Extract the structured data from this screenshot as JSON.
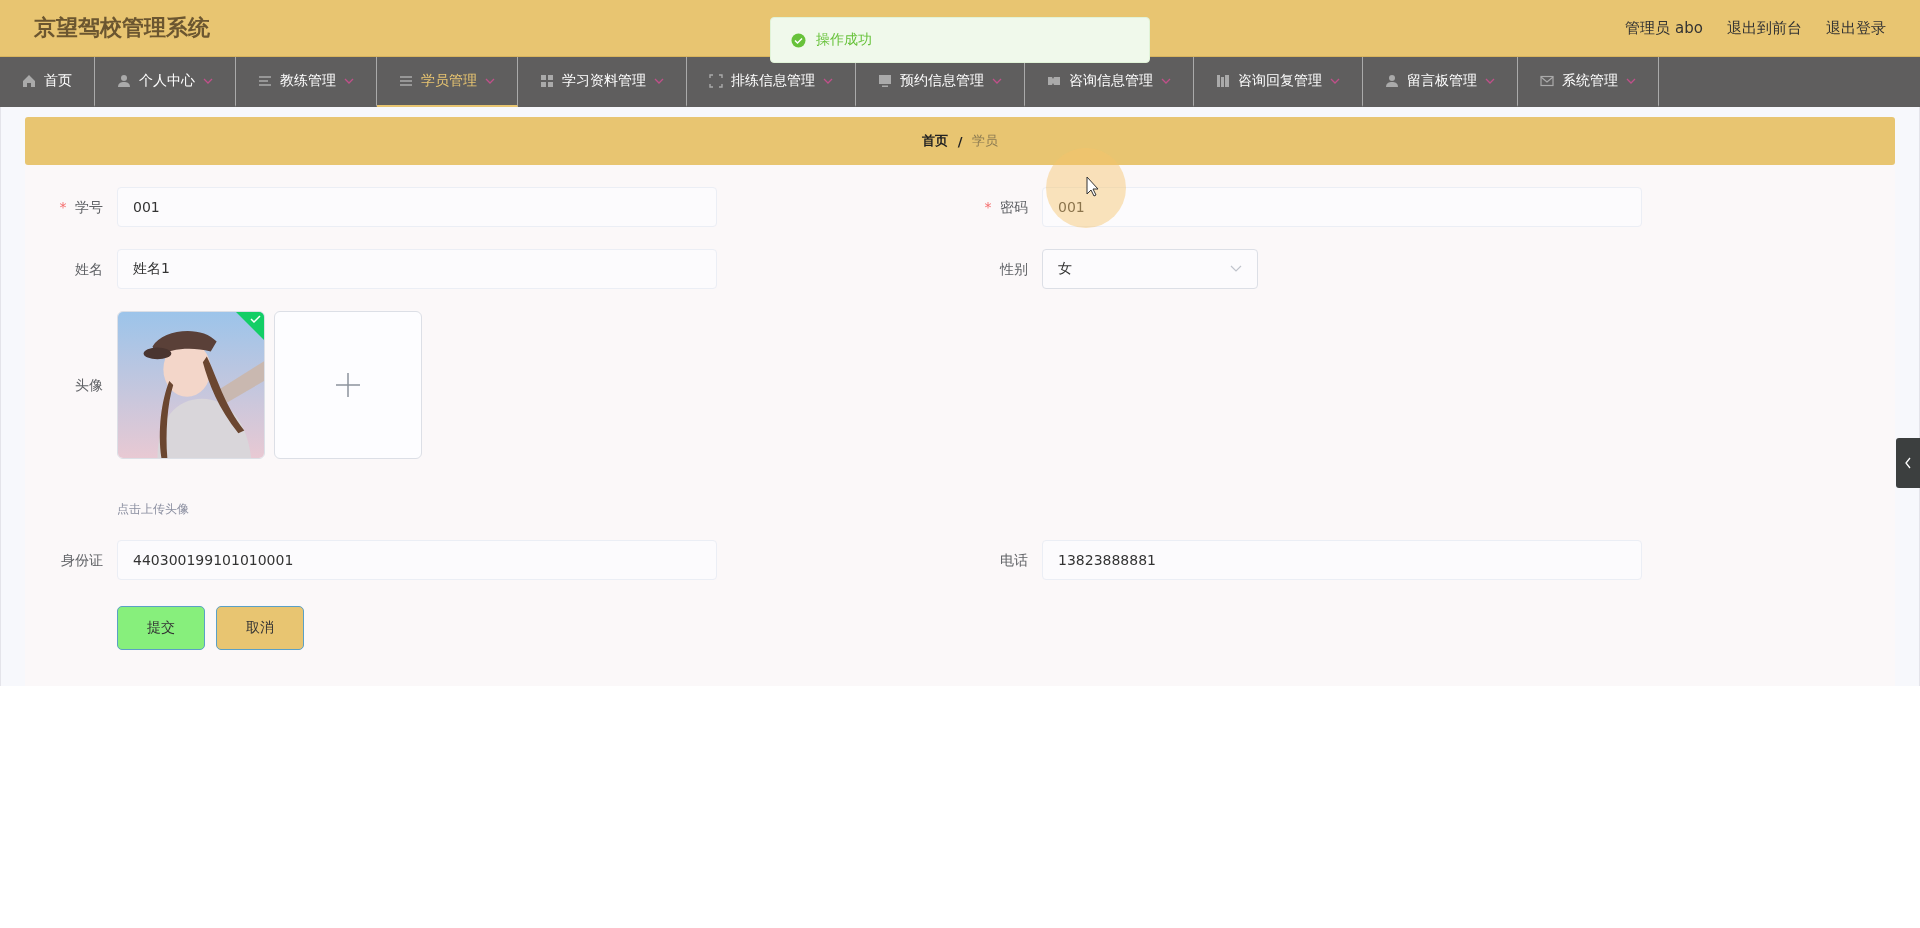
{
  "header": {
    "title": "京望驾校管理系统",
    "links": [
      "管理员 abo",
      "退出到前台",
      "退出登录"
    ]
  },
  "toast": {
    "text": "操作成功"
  },
  "nav": [
    {
      "label": "首页",
      "dropdown": false,
      "selected": false
    },
    {
      "label": "个人中心",
      "dropdown": true,
      "selected": false
    },
    {
      "label": "教练管理",
      "dropdown": true,
      "selected": false
    },
    {
      "label": "学员管理",
      "dropdown": true,
      "selected": true
    },
    {
      "label": "学习资料管理",
      "dropdown": true,
      "selected": false
    },
    {
      "label": "排练信息管理",
      "dropdown": true,
      "selected": false
    },
    {
      "label": "预约信息管理",
      "dropdown": true,
      "selected": false
    },
    {
      "label": "咨询信息管理",
      "dropdown": true,
      "selected": false
    },
    {
      "label": "咨询回复管理",
      "dropdown": true,
      "selected": false
    },
    {
      "label": "留言板管理",
      "dropdown": true,
      "selected": false
    },
    {
      "label": "系统管理",
      "dropdown": true,
      "selected": false
    }
  ],
  "breadcrumb": {
    "separator": "/",
    "items": [
      {
        "label": "首页",
        "current": false
      },
      {
        "label": "学员",
        "current": true
      }
    ]
  },
  "form": {
    "required_mark": "*",
    "rows": [
      [
        {
          "kind": "text",
          "label": "学号",
          "required": true,
          "value": "001"
        },
        {
          "kind": "text",
          "label": "密码",
          "required": true,
          "value": "001"
        }
      ],
      [
        {
          "kind": "text",
          "label": "姓名",
          "required": false,
          "value": "姓名1"
        },
        {
          "kind": "select",
          "label": "性别",
          "required": false,
          "value": "女"
        }
      ],
      [
        {
          "kind": "upload",
          "label": "头像",
          "required": false,
          "hint": "点击上传头像",
          "files": [
            {
              "kind": "picture",
              "uploaded": true
            }
          ]
        }
      ],
      [
        {
          "kind": "text",
          "label": "身份证",
          "required": false,
          "value": "440300199101010001"
        },
        {
          "kind": "text",
          "label": "电话",
          "required": false,
          "value": "13823888881"
        }
      ]
    ],
    "buttons": [
      {
        "label": "提交",
        "kind": "submit"
      },
      {
        "label": "取消",
        "kind": "cancel"
      }
    ]
  }
}
